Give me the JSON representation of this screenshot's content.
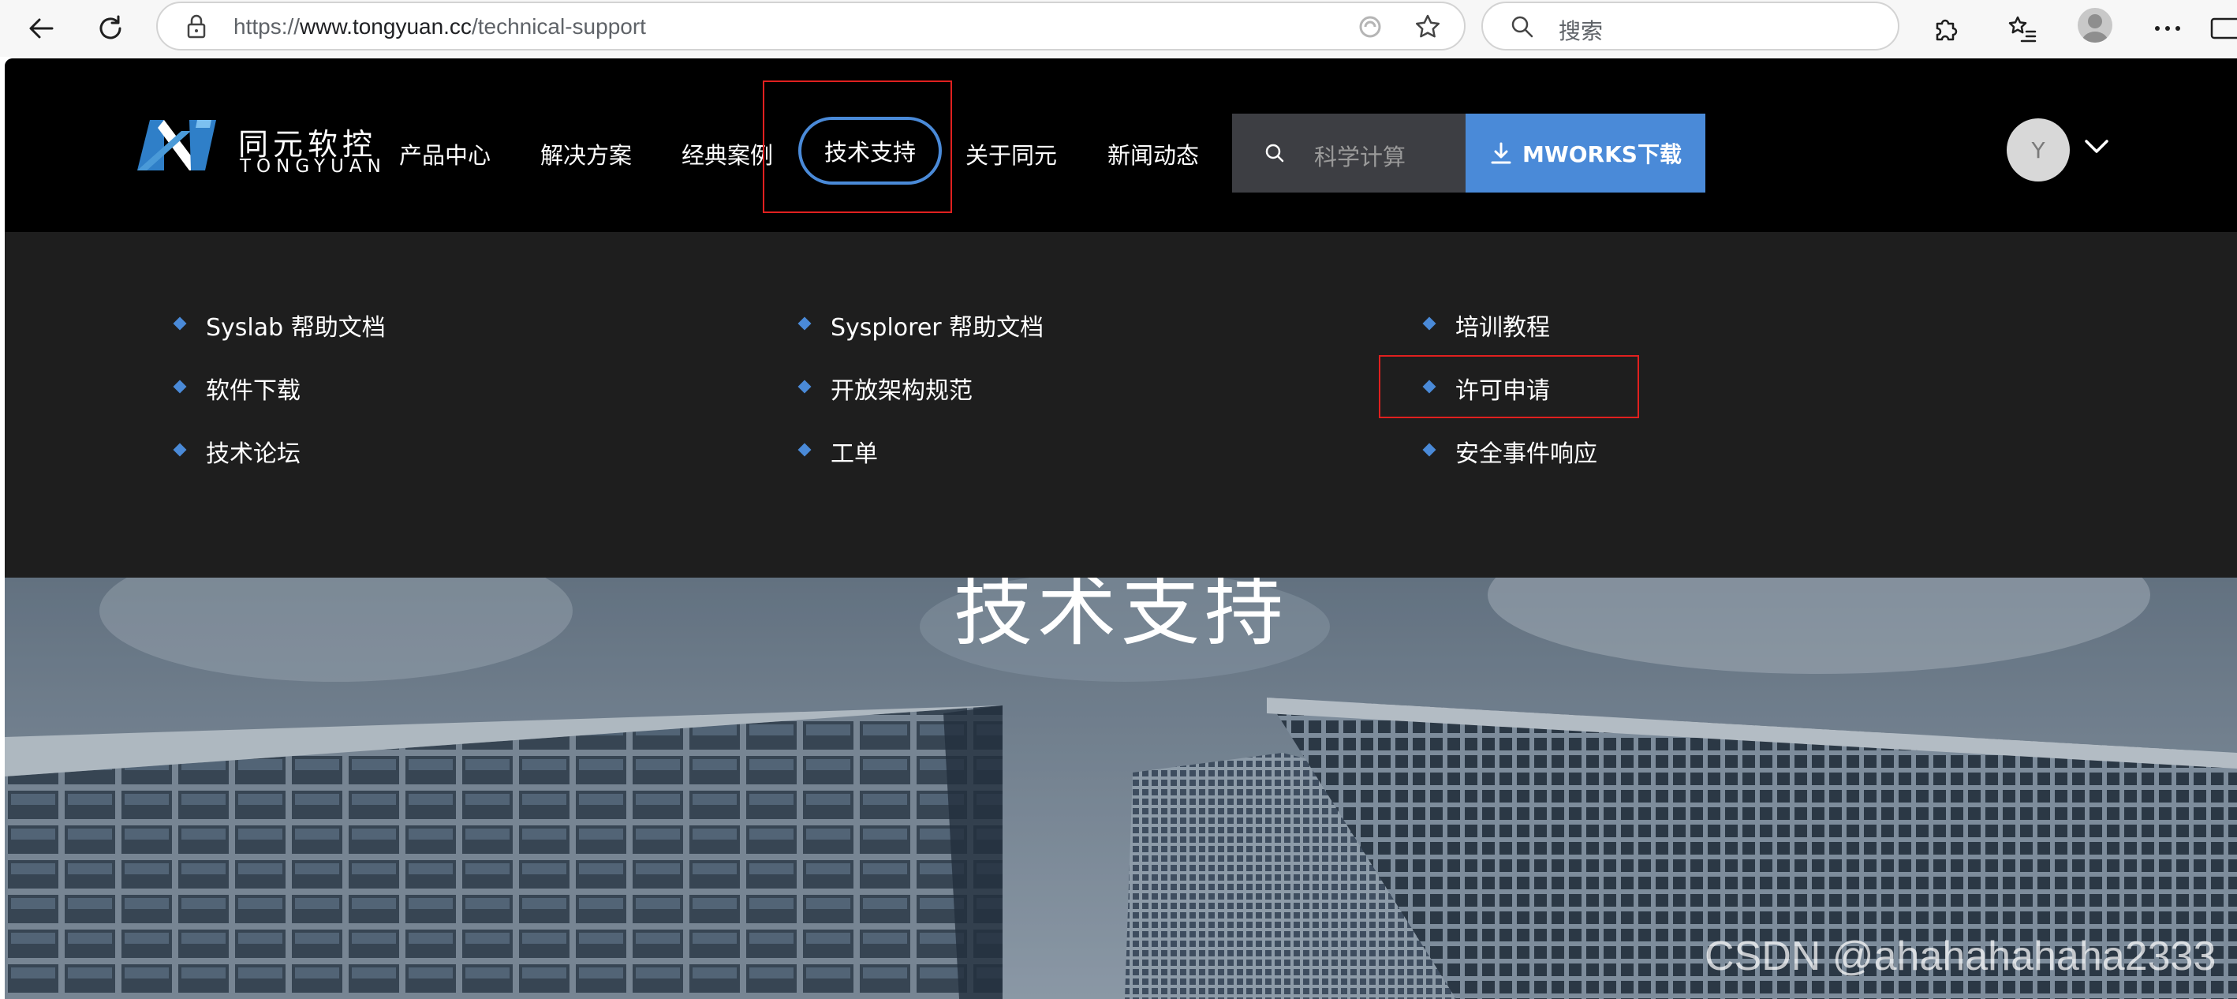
{
  "browser": {
    "url_prefix": "https://",
    "url_domain": "www.tongyuan.cc",
    "url_path": "/technical-support",
    "search_placeholder": "搜索"
  },
  "site": {
    "logo_cn": "同元软控",
    "logo_en": "TONGYUAN",
    "nav": [
      "产品中心",
      "解决方案",
      "经典案例",
      "技术支持",
      "关于同元",
      "新闻动态"
    ],
    "active_nav_index": 3,
    "search_placeholder": "科学计算",
    "download_label": "MWORKS下载",
    "user_initial": "Y",
    "dropdown": [
      [
        "Syslab 帮助文档",
        "软件下载",
        "技术论坛"
      ],
      [
        "Sysplorer 帮助文档",
        "开放架构规范",
        "工单"
      ],
      [
        "培训教程",
        "许可申请",
        "安全事件响应"
      ]
    ],
    "hero_title": "技术支持",
    "watermark": "CSDN @ahahahahaha2333"
  },
  "colors": {
    "accent": "#4a8ad8",
    "highlight_box": "#e0201f",
    "navbar_bg": "#000000",
    "dropdown_bg": "#1e1e1e"
  }
}
